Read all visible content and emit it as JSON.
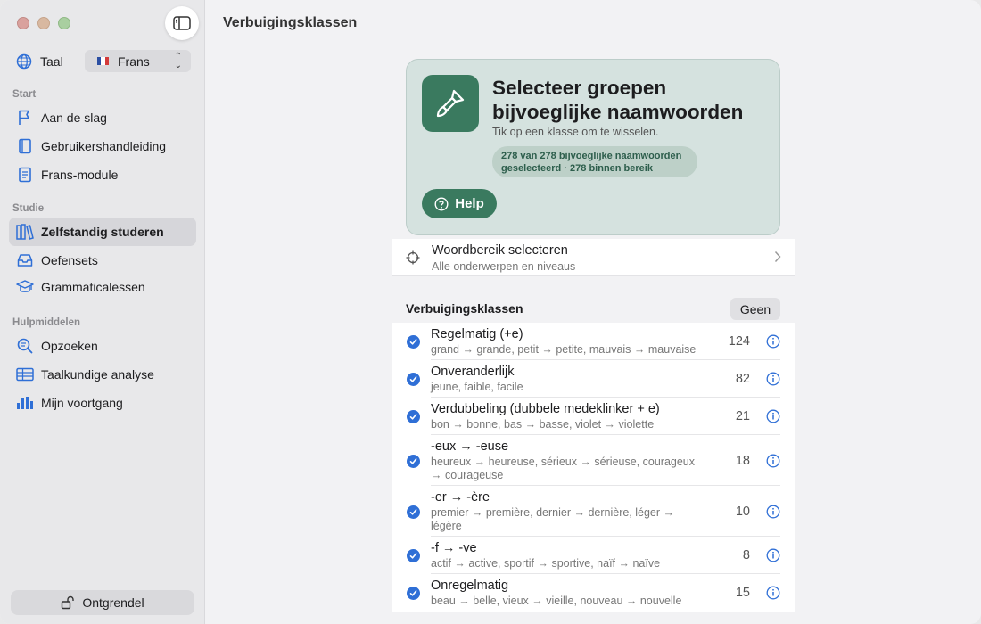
{
  "sidebar": {
    "language_label": "Taal",
    "language_value": "Frans",
    "sections": {
      "start": "Start",
      "study": "Studie",
      "tools": "Hulpmiddelen"
    },
    "items": {
      "getting_started": "Aan de slag",
      "manual": "Gebruikershandleiding",
      "french_module": "Frans-module",
      "self_study": "Zelfstandig studeren",
      "exercise_sets": "Oefensets",
      "grammar_lessons": "Grammaticalessen",
      "lookup": "Opzoeken",
      "analysis": "Taalkundige analyse",
      "progress": "Mijn voortgang"
    },
    "unlock_label": "Ontgrendel"
  },
  "main": {
    "title": "Verbuigingsklassen",
    "hero": {
      "title": "Selecteer groepen bijvoeglijke naamwoorden",
      "subtitle": "Tik op een klasse om te wisselen.",
      "pill": "278 van 278 bijvoeglijke naamwoorden geselecteerd · 278 binnen bereik",
      "help_label": "Help"
    },
    "range": {
      "title": "Woordbereik selecteren",
      "subtitle": "Alle onderwerpen en niveaus"
    },
    "list_header": "Verbuigingsklassen",
    "none_label": "Geen",
    "rows": [
      {
        "title": "Regelmatig (+e)",
        "sub": "grand → grande, petit → petite, mauvais → mauvaise",
        "count": "124"
      },
      {
        "title": "Onveranderlijk",
        "sub": "jeune, faible, facile",
        "count": "82"
      },
      {
        "title": "Verdubbeling (dubbele medeklinker + e)",
        "sub": "bon → bonne, bas → basse, violet → violette",
        "count": "21"
      },
      {
        "title": "-eux → -euse",
        "sub": "heureux → heureuse, sérieux → sérieuse, courageux → courageuse",
        "count": "18"
      },
      {
        "title": "-er → -ère",
        "sub": "premier → première, dernier → dernière, léger → légère",
        "count": "10"
      },
      {
        "title": "-f → -ve",
        "sub": "actif → active, sportif → sportive, naïf → naïve",
        "count": "8"
      },
      {
        "title": "Onregelmatig",
        "sub": "beau → belle, vieux → vieille, nouveau → nouvelle",
        "count": "15"
      }
    ]
  },
  "colors": {
    "accent_green": "#3a7a5f",
    "check_blue": "#2f6fd6"
  }
}
